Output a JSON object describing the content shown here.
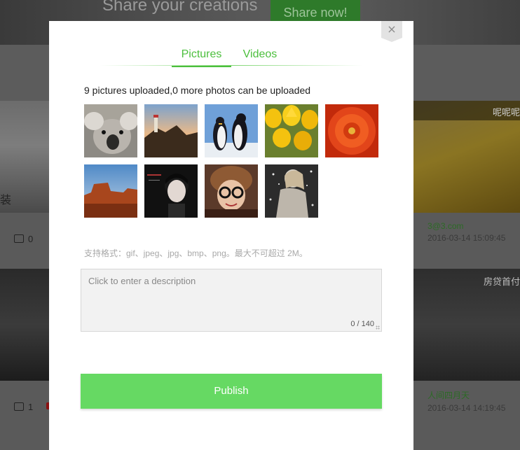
{
  "background": {
    "banner": {
      "text": "Share your creations",
      "button": "Share now!"
    },
    "cards": [
      {
        "caption": "呢呢呢",
        "left_label": "装",
        "comments": "0",
        "user": "3@3.com",
        "time": "2016-03-14 15:09:45"
      },
      {
        "caption": "房贷首付",
        "comments": "1",
        "user": "人间四月天",
        "time": "2016-03-14 14:19:45"
      }
    ]
  },
  "modal": {
    "close_symbol": "×",
    "tabs": [
      {
        "label": "Pictures",
        "active": true
      },
      {
        "label": "Videos",
        "active": false
      }
    ],
    "upload_info": "9 pictures uploaded,0 more photos can be uploaded",
    "thumbnails": [
      {
        "icon": "koala-photo"
      },
      {
        "icon": "lighthouse-sunset-photo"
      },
      {
        "icon": "penguins-photo"
      },
      {
        "icon": "yellow-tulips-photo"
      },
      {
        "icon": "red-chrysanthemum-photo"
      },
      {
        "icon": "desert-butte-photo"
      },
      {
        "icon": "portrait-woman-photo"
      },
      {
        "icon": "girl-glasses-photo"
      },
      {
        "icon": "woman-glitter-photo"
      }
    ],
    "format_note": "支持格式：gif、jpeg、jpg、bmp、png。最大不可超过 2M。",
    "description": {
      "placeholder": "Click to enter a description",
      "value": "",
      "char_count": "0 / 140"
    },
    "publish_label": "Publish"
  },
  "colors": {
    "accent": "#4cbf3d",
    "publish": "#66d963"
  }
}
